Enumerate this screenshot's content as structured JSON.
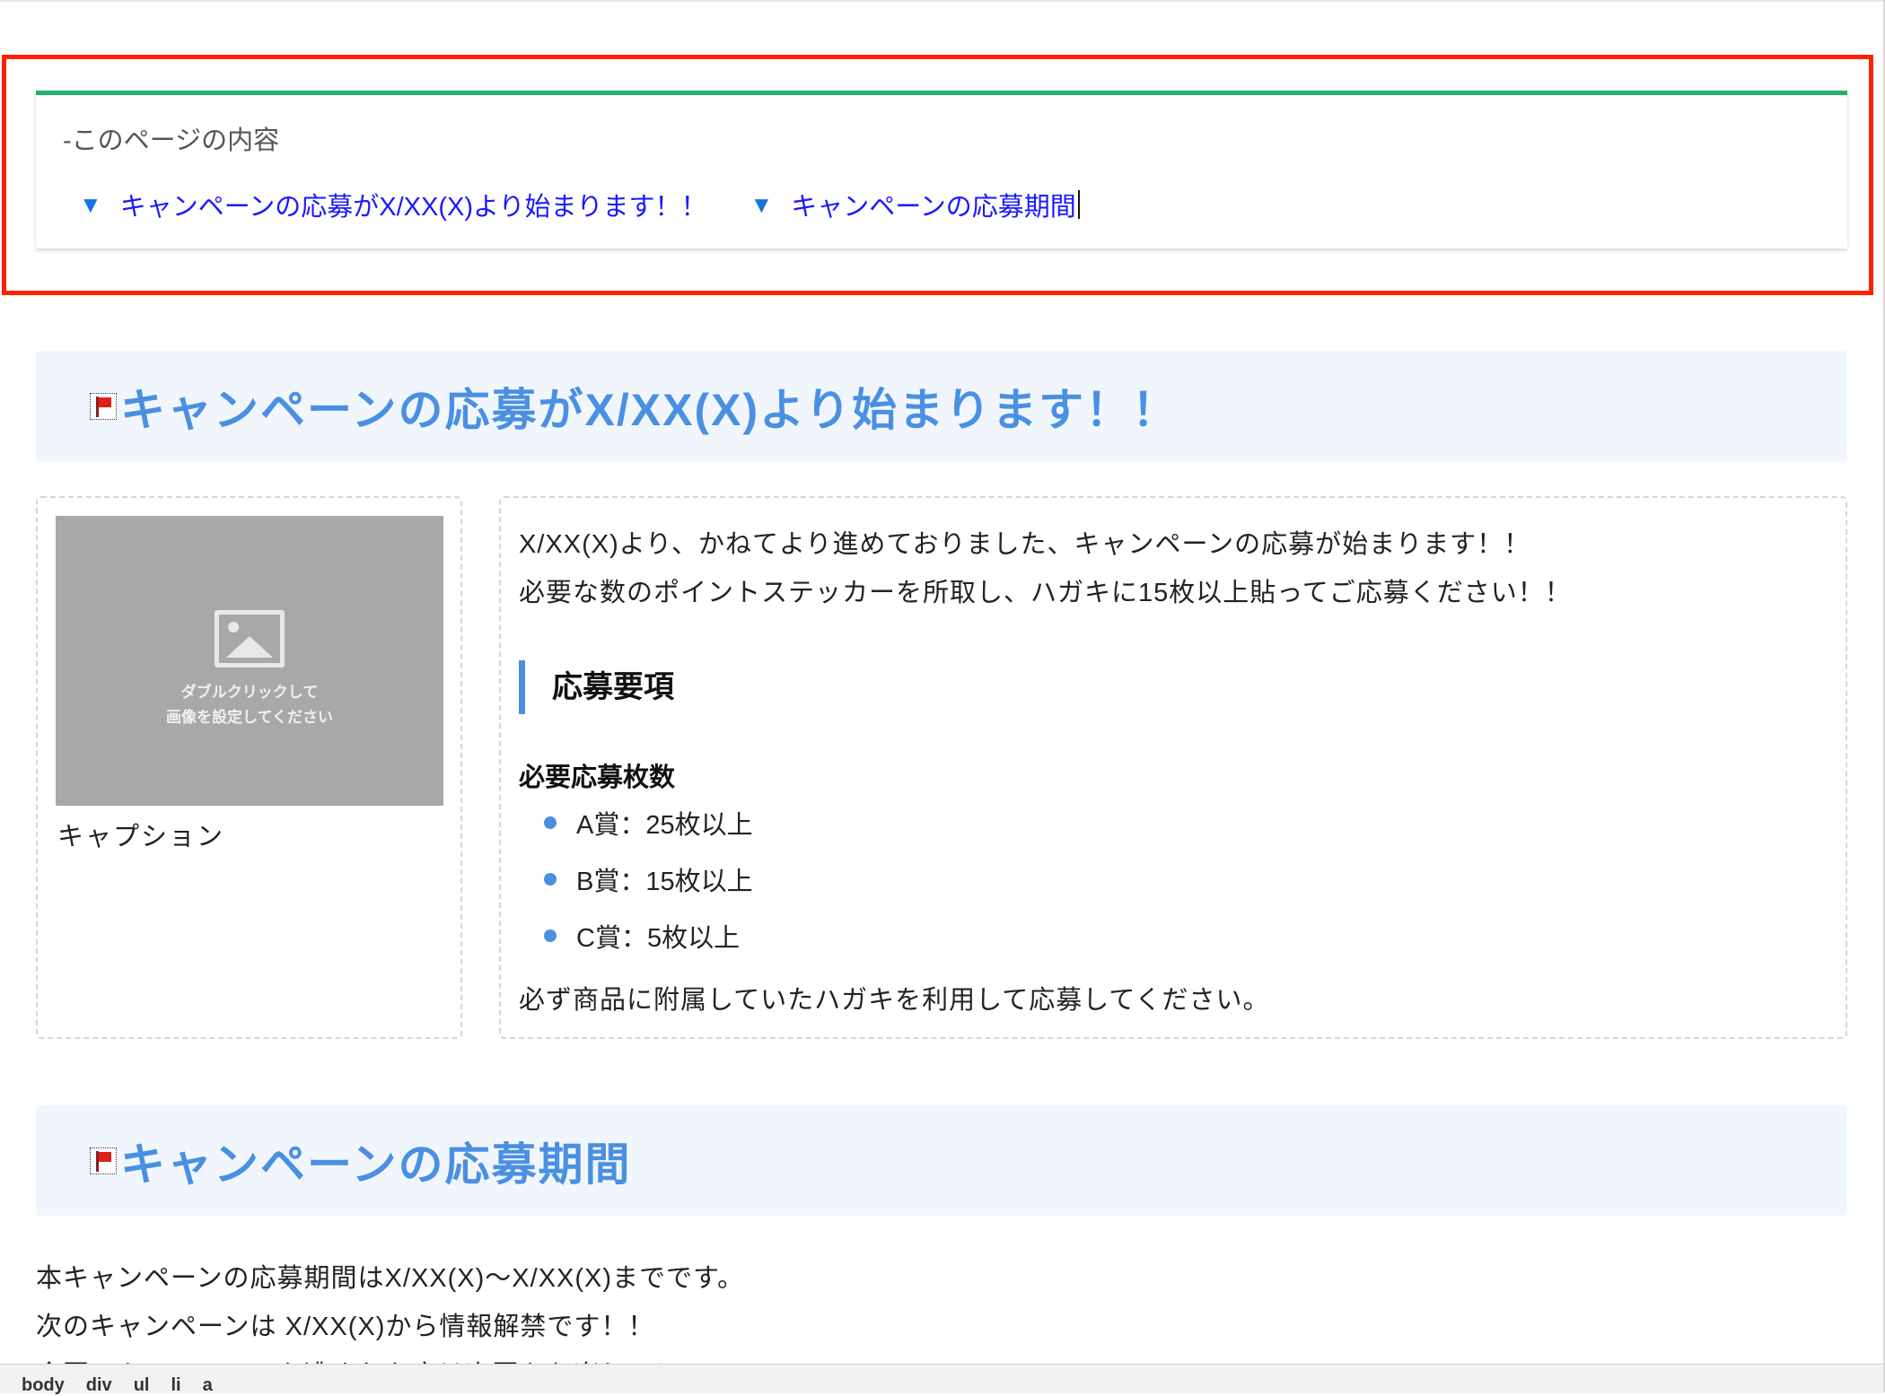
{
  "toc": {
    "title": "-このページの内容",
    "links": [
      {
        "arrow": "▼",
        "label": "キャンペーンの応募がX/XX(X)より始まります！！"
      },
      {
        "arrow": "▼",
        "label": "キャンペーンの応募期間"
      }
    ]
  },
  "section1": {
    "heading": "キャンペーンの応募がX/XX(X)より始まります！！",
    "image_placeholder_line1": "ダブルクリックして",
    "image_placeholder_line2": "画像を設定してください",
    "caption": "キャプション",
    "para1": "X/XX(X)より、かねてより進めておりました、キャンペーンの応募が始まります！！",
    "para2": "必要な数のポイントステッカーを所取し、ハガキに15枚以上貼ってご応募ください！！",
    "subheading": "応募要項",
    "requirements_label": "必要応募枚数",
    "requirements": [
      "A賞：25枚以上",
      "B賞：15枚以上",
      "C賞：5枚以上"
    ],
    "note": "必ず商品に附属していたハガキを利用して応募してください。"
  },
  "section2": {
    "heading": "キャンペーンの応募期間",
    "line1": "本キャンペーンの応募期間はX/XX(X)〜X/XX(X)までです。",
    "line2": "次のキャンペーンは X/XX(X)から情報解禁です！！",
    "line3": "今回のキャンペーンを逃された方は次回をお楽しみに！！"
  },
  "status_bar": {
    "breadcrumbs": [
      "body",
      "div",
      "ul",
      "li",
      "a"
    ]
  },
  "colors": {
    "highlight_border": "#ff2200",
    "toc_top_border": "#23b26a",
    "link": "#1a18ff",
    "heading": "#4a90e2",
    "heading_bg": "#f1f6fd"
  }
}
